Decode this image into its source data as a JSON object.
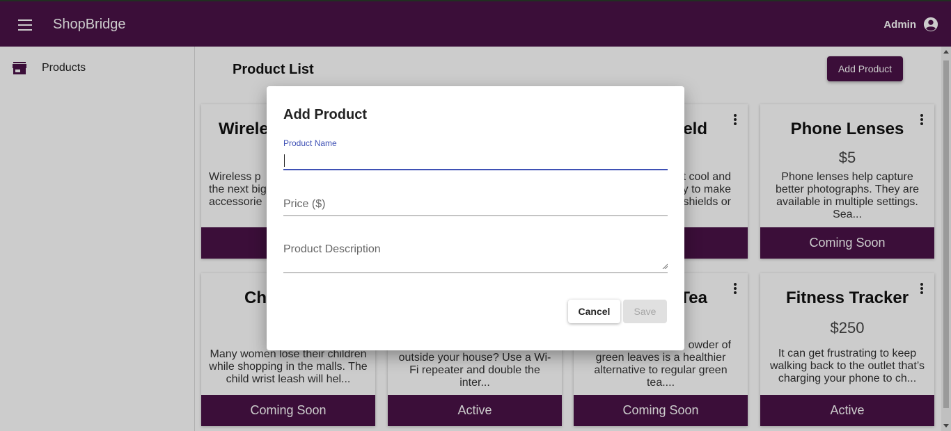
{
  "appbar": {
    "title": "ShopBridge",
    "user_label": "Admin",
    "bg": "#4a1248"
  },
  "sidebar": {
    "items": [
      {
        "label": "Products",
        "icon": "store-icon"
      }
    ]
  },
  "main": {
    "title": "Product List",
    "add_button": "Add Product",
    "cards": [
      {
        "name": "Wirele",
        "price": "",
        "desc": [
          "Wireless p",
          "the next big",
          "accessorie"
        ],
        "status": ""
      },
      {
        "name": "eld",
        "price": "",
        "desc": [
          "t cool and",
          "y to make",
          "shields or"
        ],
        "status": ""
      },
      {
        "name": "Phone Lenses",
        "price": "$5",
        "desc": [
          "Phone lenses help capture",
          "better photographs. They are",
          "available in multiple settings.",
          "Sea..."
        ],
        "status": "Coming Soon"
      },
      {
        "name": "Ch",
        "price": "",
        "desc": [
          "Many women lose their children",
          "while shopping in the malls. The",
          "child wrist leash will hel..."
        ],
        "status": "Coming Soon"
      },
      {
        "name": "",
        "price": "",
        "desc": [
          "outside your house? Use a Wi-",
          "Fi repeater and double the",
          "inter..."
        ],
        "status": "Active"
      },
      {
        "name": "Tea",
        "price": "",
        "desc": [
          "owder of",
          "green leaves is a healthier",
          "alternative to regular green",
          "tea...."
        ],
        "status": "Coming Soon"
      },
      {
        "name": "Fitness Tracker",
        "price": "$250",
        "desc": [
          "It can get frustrating to keep",
          "walking back to the outlet that’s",
          "charging your phone to ch..."
        ],
        "status": "Active"
      }
    ]
  },
  "dialog": {
    "title": "Add Product",
    "name_label": "Product Name",
    "name_value": "",
    "price_placeholder": "Price ($)",
    "description_placeholder": "Product Description",
    "cancel": "Cancel",
    "save": "Save"
  }
}
